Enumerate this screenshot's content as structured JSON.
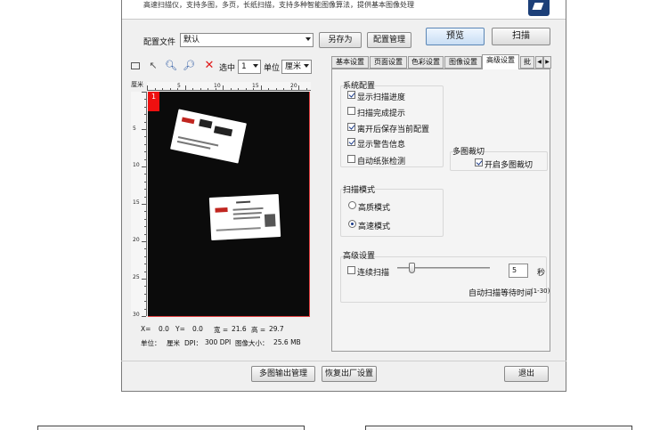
{
  "banner": {
    "text": "高速扫描仪，支持多图，多页，长纸扫描，支持多种智能图像算法，提供基本图像处理"
  },
  "config": {
    "label": "配置文件",
    "value": "默认",
    "save_as": "另存为",
    "manage": "配置管理"
  },
  "actions": {
    "preview": "预览",
    "scan": "扫描"
  },
  "toolbar": {
    "select_label": "选中",
    "select_value": "1",
    "unit_label": "单位",
    "unit_value": "厘米"
  },
  "ruler": {
    "unit": "厘米",
    "top_marks": [
      "5",
      "10",
      "15",
      "20"
    ],
    "left_marks": [
      "5",
      "10",
      "15",
      "20",
      "25",
      "30"
    ]
  },
  "preview": {
    "page_tag": "1"
  },
  "status": {
    "x_label": "X=",
    "x_value": "0.0",
    "y_label": "Y=",
    "y_value": "0.0",
    "width_label": "宽 =",
    "width_value": "21.6",
    "height_label": "高 =",
    "height_value": "29.7",
    "unit_label": "单位：",
    "unit_value": "厘米",
    "dpi_label": "DPI：",
    "dpi_value": "300 DPI",
    "size_label": "图像大小：",
    "size_value": "25.6 MB"
  },
  "tabs": [
    {
      "label": "基本设置"
    },
    {
      "label": "页面设置"
    },
    {
      "label": "色彩设置"
    },
    {
      "label": "图像设置"
    },
    {
      "label": "高级设置"
    },
    {
      "label": "批"
    }
  ],
  "active_tab": "高级设置",
  "system": {
    "title": "系统配置",
    "items": [
      {
        "label": "显示扫描进度",
        "checked": true
      },
      {
        "label": "扫描完成提示",
        "checked": false
      },
      {
        "label": "离开后保存当前配置",
        "checked": true
      },
      {
        "label": "显示警告信息",
        "checked": true
      },
      {
        "label": "自动纸张检测",
        "checked": false
      }
    ]
  },
  "multi_crop": {
    "title": "多图裁切",
    "option": "开启多图裁切",
    "checked": true
  },
  "scan_mode": {
    "title": "扫描模式",
    "options": [
      {
        "label": "高质模式",
        "selected": false
      },
      {
        "label": "高速模式",
        "selected": true
      }
    ]
  },
  "advanced": {
    "title": "高级设置",
    "continuous_label": "连续扫描",
    "continuous_checked": false,
    "wait_value": "5",
    "wait_unit": "秒",
    "wait_caption": "自动扫描等待时间",
    "wait_range": "(1-30)"
  },
  "footer": {
    "multi_output": "多图输出管理",
    "restore": "恢复出厂设置",
    "exit": "退出"
  }
}
